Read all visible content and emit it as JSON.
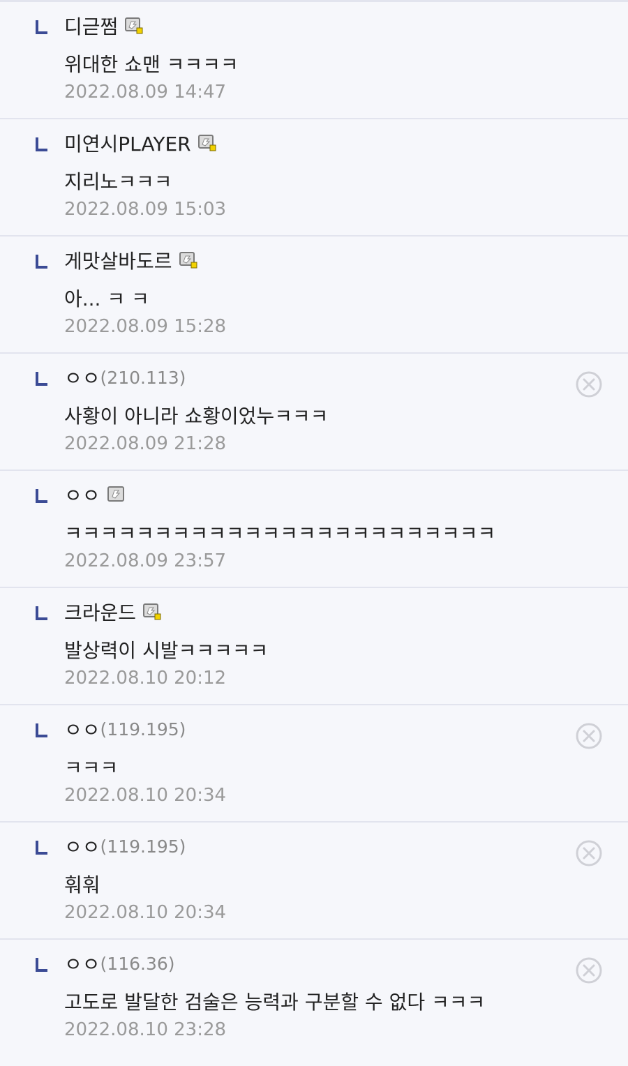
{
  "comments": [
    {
      "nickname": "디귿쩜",
      "ip": "",
      "member_icon": "fixed-member-icon",
      "text": "위대한 쇼맨 ㅋㅋㅋㅋ",
      "date": "2022.08.09 14:47",
      "deletable": false
    },
    {
      "nickname": "미연시PLAYER",
      "ip": "",
      "member_icon": "fixed-member-icon",
      "text": "지리노ㅋㅋㅋ",
      "date": "2022.08.09 15:03",
      "deletable": false
    },
    {
      "nickname": "게맛살바도르",
      "ip": "",
      "member_icon": "fixed-member-icon",
      "text": "아... ㅋ ㅋ",
      "date": "2022.08.09 15:28",
      "deletable": false
    },
    {
      "nickname": "ㅇㅇ",
      "ip": "(210.113)",
      "member_icon": "",
      "text": "사황이 아니라 쇼황이었누ㅋㅋㅋ",
      "date": "2022.08.09 21:28",
      "deletable": true
    },
    {
      "nickname": "ㅇㅇ",
      "ip": "",
      "member_icon": "semi-member-icon",
      "text": "ㅋㅋㅋㅋㅋㅋㅋㅋㅋㅋㅋㅋㅋㅋㅋㅋㅋㅋㅋㅋㅋㅋㅋㅋ",
      "date": "2022.08.09 23:57",
      "deletable": false
    },
    {
      "nickname": "크라운드",
      "ip": "",
      "member_icon": "fixed-member-icon",
      "text": "발상력이 시발ㅋㅋㅋㅋㅋ",
      "date": "2022.08.10 20:12",
      "deletable": false
    },
    {
      "nickname": "ㅇㅇ",
      "ip": "(119.195)",
      "member_icon": "",
      "text": "ㅋㅋㅋ",
      "date": "2022.08.10 20:34",
      "deletable": true
    },
    {
      "nickname": "ㅇㅇ",
      "ip": "(119.195)",
      "member_icon": "",
      "text": "훠훠",
      "date": "2022.08.10 20:34",
      "deletable": true
    },
    {
      "nickname": "ㅇㅇ",
      "ip": "(116.36)",
      "member_icon": "",
      "text": "고도로 발달한 검술은 능력과 구분할 수 없다 ㅋㅋㅋ",
      "date": "2022.08.10 23:28",
      "deletable": true
    }
  ],
  "colors": {
    "background": "#f6f7fb",
    "divider": "#e2e4ee",
    "reply_marker": "#3b4b95",
    "text": "#222222",
    "ip_text": "#8a8a8a",
    "date_text": "#9a9a9a",
    "icon_badge": "#f2d200"
  }
}
